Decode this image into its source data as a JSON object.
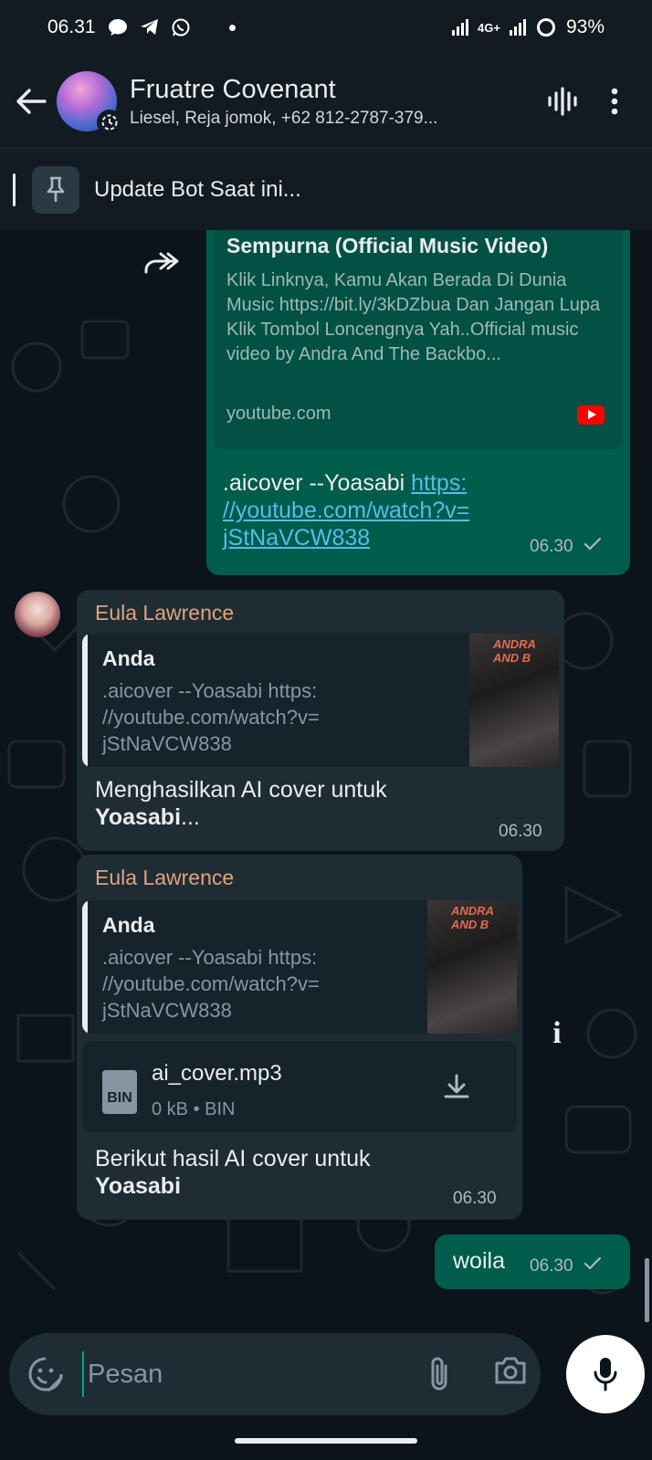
{
  "status": {
    "time": "06.31",
    "network": "4G+",
    "battery": "93%"
  },
  "header": {
    "title": "Fruatre Covenant",
    "subtitle": "Liesel, Reja jomok, +62 812-2787-379..."
  },
  "pinned": {
    "text": "Update Bot Saat ini..."
  },
  "messages": {
    "m1": {
      "preview_title": "Sempurna (Official Music Video)",
      "preview_desc": "Klik Linknya, Kamu Akan Berada Di Dunia Music https://bit.ly/3kDZbua Dan Jangan Lupa Klik Tombol Loncengnya Yah..Official music video by Andra And The Backbo...",
      "preview_domain": "youtube.com",
      "text": ".aicover --Yoasabi ",
      "link": "https://youtube.com/watch?v=jStNaVCW838",
      "link_l1": "https:",
      "link_l2": "//youtube.com/watch?v=",
      "link_l3": "jStNaVCW838",
      "time": "06.30"
    },
    "m2": {
      "sender": "Eula Lawrence",
      "quote_author": "Anda",
      "quote_l1": ".aicover --Yoasabi https:",
      "quote_l2": "//youtube.com/watch?v=",
      "quote_l3": "jStNaVCW838",
      "thumb_text": "ANDRA AND B",
      "text_plain": "Menghasilkan AI cover untuk",
      "text_bold": "Yoasabi",
      "text_tail": "...",
      "time": "06.30"
    },
    "m3": {
      "sender": "Eula Lawrence",
      "quote_author": "Anda",
      "quote_l1": ".aicover --Yoasabi https:",
      "quote_l2": "//youtube.com/watch?v=",
      "quote_l3": "jStNaVCW838",
      "thumb_text": "ANDRA AND B",
      "file_name": "ai_cover.mp3",
      "file_meta": "0 kB • BIN",
      "file_badge": "BIN",
      "text_plain": "Berikut hasil AI cover untuk",
      "text_bold": "Yoasabi",
      "time": "06.30"
    },
    "m4": {
      "text": "woila",
      "time": "06.30"
    }
  },
  "composer": {
    "placeholder": "Pesan"
  },
  "colors": {
    "outgoing_bubble": "#005c4b",
    "incoming_bubble": "#1f2c34",
    "background": "#0b141a",
    "link": "#53bdeb",
    "sender_name": "#e0a27d",
    "accent": "#00a884"
  },
  "icons": {
    "back": "arrow-left-icon",
    "voice_chat": "waveform-icon",
    "menu": "more-vert-icon",
    "pin": "pin-icon",
    "forward": "forward-icon",
    "emoji": "sticker-icon",
    "attach": "paperclip-icon",
    "camera": "camera-icon",
    "mic": "mic-icon",
    "download": "download-icon"
  }
}
